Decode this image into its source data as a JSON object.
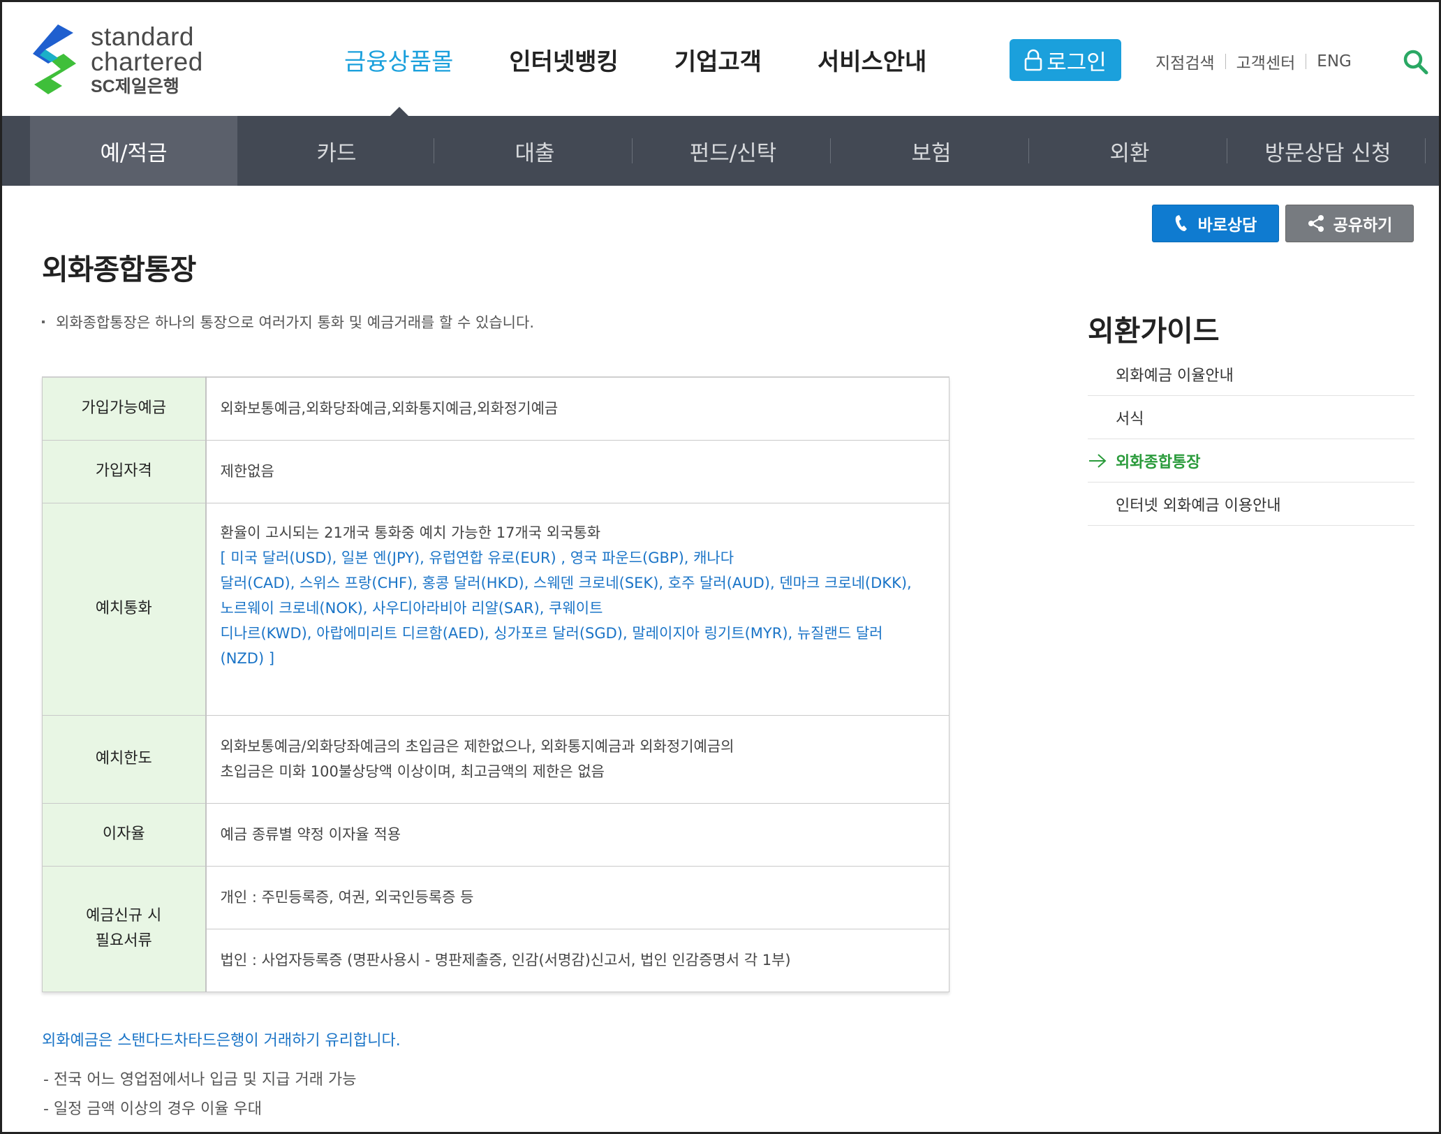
{
  "brand": {
    "logo_line1": "standard",
    "logo_line2": "chartered",
    "logo_line3": "SC제일은행",
    "colors": {
      "logo_blue": "#1f5fcf",
      "logo_green": "#3fbf3a",
      "accent": "#1ba0dc",
      "active_guide": "#2a9b3b"
    }
  },
  "gnb": {
    "items": [
      "금융상품몰",
      "인터넷뱅킹",
      "기업고객",
      "서비스안내"
    ],
    "active_index": 0
  },
  "login_label": "로그인",
  "util": {
    "branch": "지점검색",
    "center": "고객센터",
    "lang": "ENG"
  },
  "lnb": {
    "items": [
      "예/적금",
      "카드",
      "대출",
      "펀드/신탁",
      "보험",
      "외환",
      "방문상담 신청"
    ],
    "active_index": 0
  },
  "actions": {
    "call": "바로상담",
    "share": "공유하기"
  },
  "page": {
    "title": "외화종합통장",
    "intro": "외화종합통장은 하나의 통장으로 여러가지 통화 및 예금거래를 할 수 있습니다."
  },
  "table": {
    "row1": {
      "header": "가입가능예금",
      "value": "외화보통예금,외화당좌예금,외화통지예금,외화정기예금"
    },
    "row2": {
      "header": "가입자격",
      "value": "제한없음"
    },
    "row3": {
      "header": "예치통화",
      "line1": "환율이 고시되는 21개국 통화중 예치 가능한 17개국 외국통화",
      "blue1": "[ 미국 달러(USD), 일본 엔(JPY), 유럽연합 유로(EUR) , 영국 파운드(GBP), 캐나다",
      "blue2": "달러(CAD), 스위스 프랑(CHF), 홍콩 달러(HKD), 스웨덴 크로네(SEK), 호주 달러(AUD), 덴마크 크로네(DKK),",
      "blue3": "노르웨이 크로네(NOK), 사우디아라비아 리얄(SAR), 쿠웨이트",
      "blue4": "디나르(KWD), 아랍에미리트 디르함(AED), 싱가포르 달러(SGD), 말레이지아 링기트(MYR), 뉴질랜드 달러",
      "blue5": "(NZD) ]"
    },
    "row4": {
      "header": "예치한도",
      "line1": "외화보통예금/외화당좌예금의 초입금은 제한없으나, 외화통지예금과 외화정기예금의",
      "line2": "초입금은 미화 100불상당액 이상이며, 최고금액의 제한은 없음"
    },
    "row5": {
      "header": "이자율",
      "value": "예금 종류별 약정 이자율 적용"
    },
    "row6": {
      "header_line1": "예금신규 시",
      "header_line2": "필요서류",
      "personal": "개인 : 주민등록증, 여권, 외국인등록증 등",
      "corporate": "법인 : 사업자등록증 (명판사용시 - 명판제출증, 인감(서명감)신고서, 법인 인감증명서 각 1부)"
    }
  },
  "notes": {
    "head": "외화예금은 스탠다드차타드은행이 거래하기 유리합니다.",
    "line1": "- 전국 어느 영업점에서나 입금 및 지급 거래 가능",
    "line2": "- 일정 금액 이상의 경우 이율 우대"
  },
  "guide": {
    "title": "외환가이드",
    "items": [
      "외화예금 이율안내",
      "서식",
      "외화종합통장",
      "인터넷 외화예금 이용안내"
    ],
    "active_index": 2
  }
}
